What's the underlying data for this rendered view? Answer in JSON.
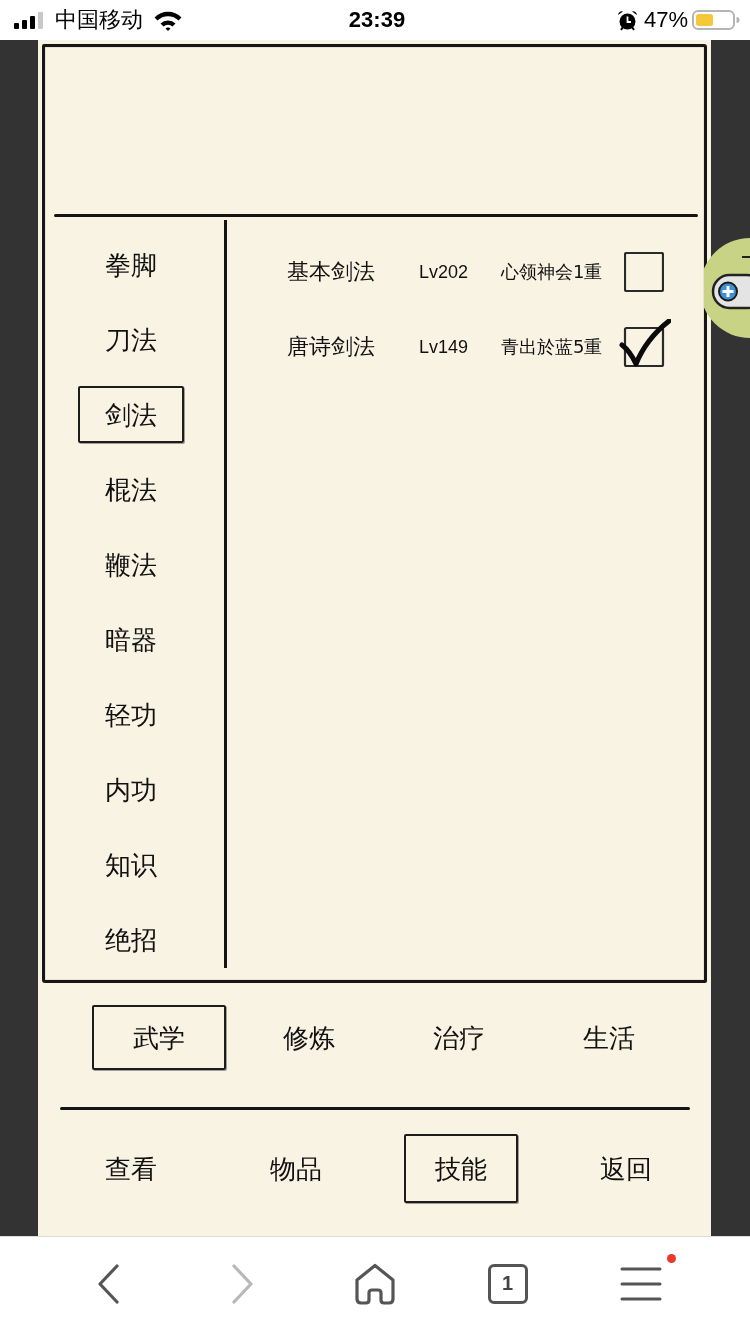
{
  "status_bar": {
    "carrier": "中国移动",
    "time": "23:39",
    "battery": "47%"
  },
  "categories": [
    {
      "label": "拳脚",
      "selected": false
    },
    {
      "label": "刀法",
      "selected": false
    },
    {
      "label": "剑法",
      "selected": true
    },
    {
      "label": "棍法",
      "selected": false
    },
    {
      "label": "鞭法",
      "selected": false
    },
    {
      "label": "暗器",
      "selected": false
    },
    {
      "label": "轻功",
      "selected": false
    },
    {
      "label": "内功",
      "selected": false
    },
    {
      "label": "知识",
      "selected": false
    },
    {
      "label": "绝招",
      "selected": false
    }
  ],
  "skills": [
    {
      "name": "基本剑法",
      "lv": "Lv202",
      "rank": "心领神会1重",
      "checked": false
    },
    {
      "name": "唐诗剑法",
      "lv": "Lv149",
      "rank": "青出於蓝5重",
      "checked": true
    }
  ],
  "tabs": [
    {
      "label": "武学",
      "selected": true
    },
    {
      "label": "修炼",
      "selected": false
    },
    {
      "label": "治疗",
      "selected": false
    },
    {
      "label": "生活",
      "selected": false
    }
  ],
  "menu": [
    {
      "label": "查看",
      "selected": false
    },
    {
      "label": "物品",
      "selected": false
    },
    {
      "label": "技能",
      "selected": true
    },
    {
      "label": "返回",
      "selected": false
    }
  ],
  "browser_toolbar": {
    "tab_count": "1",
    "forward_disabled": true,
    "notification": true
  }
}
